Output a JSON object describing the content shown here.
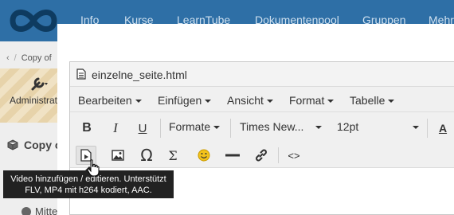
{
  "nav": {
    "items": [
      "Info",
      "Kurse",
      "LearnTube",
      "Dokumentenpool",
      "Gruppen",
      "Mehr"
    ]
  },
  "sidebar": {
    "breadcrumb": "Copy of",
    "admin_label": "Administration",
    "copy_title": "Copy o",
    "info_label": "Mitte"
  },
  "editor": {
    "title": "einzelne_seite.html",
    "menus": [
      "Bearbeiten",
      "Einfügen",
      "Ansicht",
      "Format",
      "Tabelle"
    ],
    "toolbar": {
      "bold": "B",
      "italic": "I",
      "underline": "U",
      "formats_label": "Formate",
      "font_family": "Times New...",
      "font_size": "12pt",
      "text_color": "A",
      "omega": "Ω",
      "sigma": "Σ",
      "code": "<>"
    }
  },
  "tooltip": {
    "line1": "Video hinzufügen / editieren. Unterstützt",
    "line2": "FLV, MP4 mit h264 kodiert, AAC."
  },
  "colors": {
    "topnav": "#2e6fa6",
    "smiley": "#f2c21b"
  },
  "icons": [
    "logo-icon",
    "chevron-left-icon",
    "wrench-icon",
    "cube-icon",
    "info-icon",
    "document-icon",
    "video-icon",
    "image-icon",
    "smiley-icon",
    "horizontal-rule-icon",
    "link-icon",
    "cursor-hand-icon"
  ]
}
